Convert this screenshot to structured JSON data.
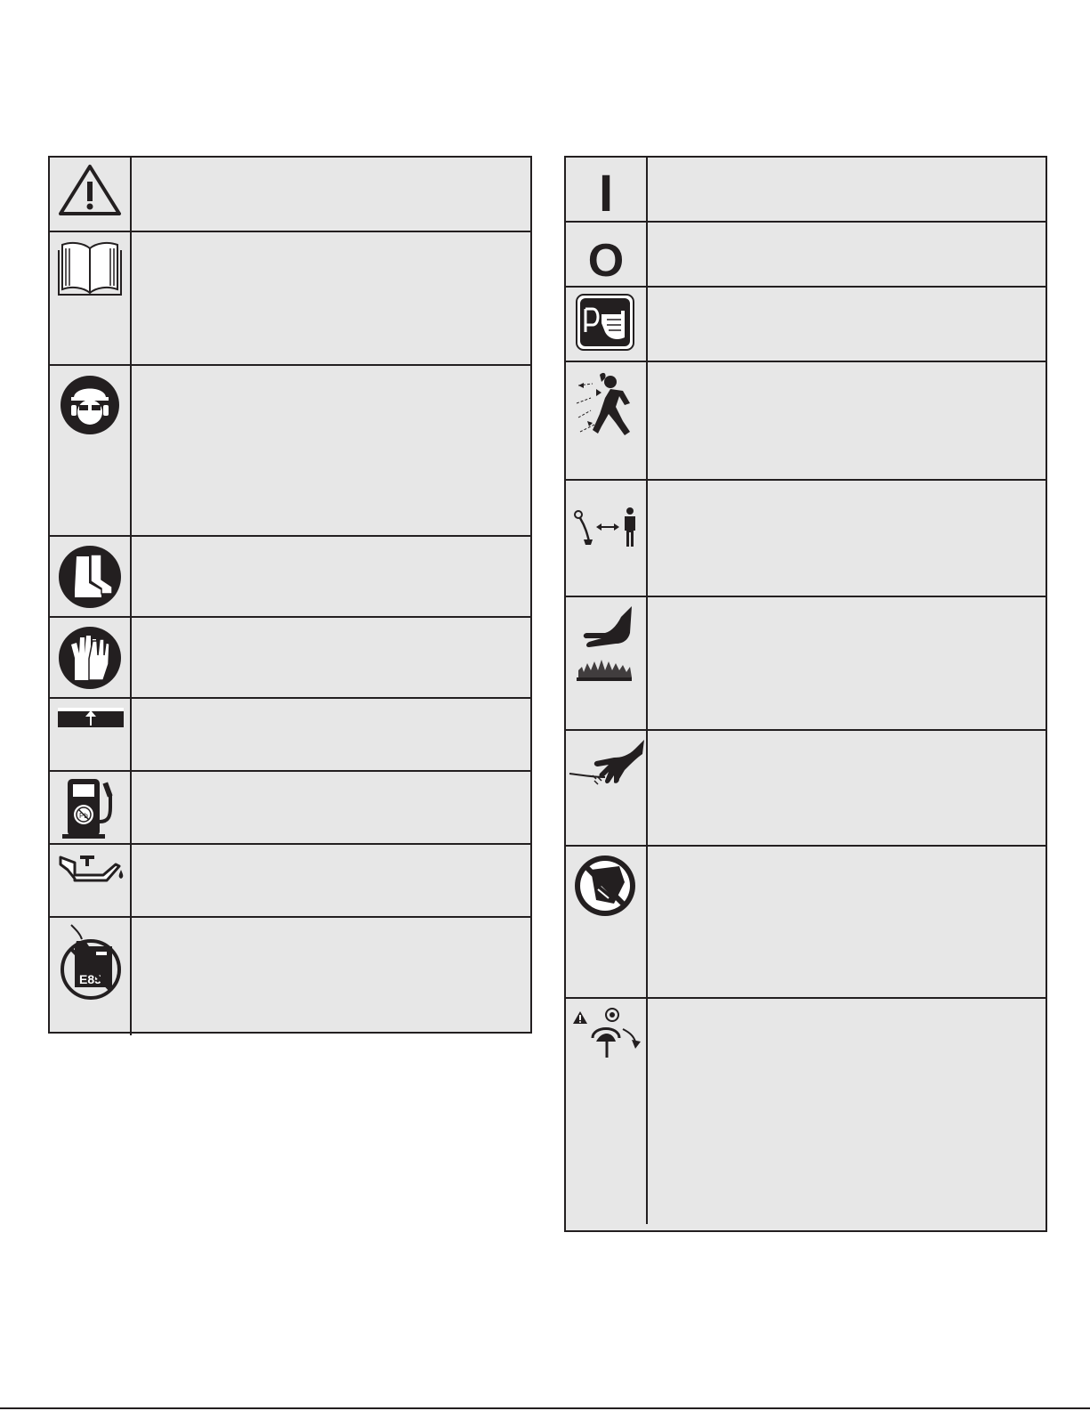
{
  "page": {
    "colors": {
      "ink": "#231f20",
      "cell_fill": "#e7e7e7",
      "paper": "#ffffff"
    }
  },
  "left_table": {
    "rows": [
      {
        "icon": "warning-triangle-icon",
        "text": ""
      },
      {
        "icon": "read-manual-icon",
        "text": ""
      },
      {
        "icon": "head-eye-ear-protection-icon",
        "text": ""
      },
      {
        "icon": "safety-boots-icon",
        "text": ""
      },
      {
        "icon": "gloves-icon",
        "text": ""
      },
      {
        "icon": "choke-lever-icon",
        "text": ""
      },
      {
        "icon": "unleaded-fuel-pump-icon",
        "text": ""
      },
      {
        "icon": "oil-can-icon",
        "text": ""
      },
      {
        "icon": "no-e85-fuel-icon",
        "text": ""
      }
    ]
  },
  "right_table": {
    "rows": [
      {
        "icon": "on-position-icon",
        "glyph": "I",
        "text": ""
      },
      {
        "icon": "off-position-icon",
        "glyph": "O",
        "text": ""
      },
      {
        "icon": "primer-bulb-icon",
        "text": ""
      },
      {
        "icon": "thrown-objects-icon",
        "text": ""
      },
      {
        "icon": "bystander-distance-icon",
        "text": ""
      },
      {
        "icon": "hot-surface-icon",
        "text": ""
      },
      {
        "icon": "rotating-line-hand-icon",
        "text": ""
      },
      {
        "icon": "no-blade-icon",
        "text": ""
      },
      {
        "icon": "head-rotation-warning-icon",
        "text": ""
      }
    ]
  }
}
